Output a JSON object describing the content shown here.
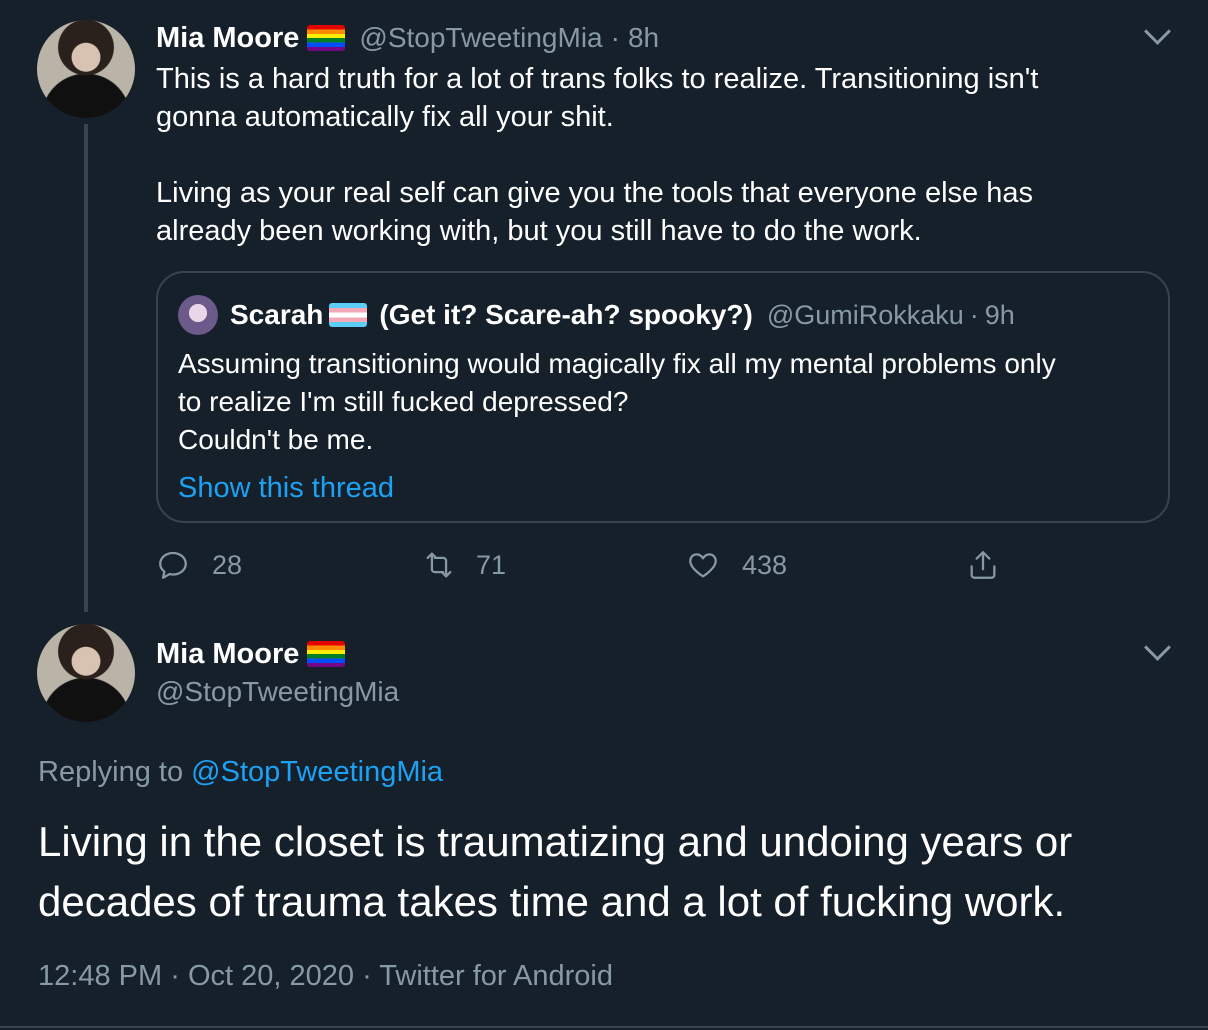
{
  "parent_tweet": {
    "author_name": "Mia Moore",
    "handle": "@StopTweetingMia",
    "separator": "·",
    "time": "8h",
    "lines": [
      "This is a hard truth for a lot of trans folks to realize. Transitioning isn't",
      "gonna automatically fix all your shit.",
      "Living as your real self can give you the tools that everyone else has",
      "already been working with, but you still have to do the work."
    ],
    "quoted": {
      "author_name": "Scarah",
      "display_suffix": "(Get it? Scare-ah? spooky?)",
      "handle": "@GumiRokkaku",
      "separator": "·",
      "time": "9h",
      "lines": [
        "Assuming transitioning would magically fix all my mental problems only",
        "to realize I'm still fucked depressed?",
        "Couldn't be me."
      ],
      "show_thread": "Show this thread"
    },
    "actions": {
      "replies": "28",
      "retweets": "71",
      "likes": "438"
    }
  },
  "main_tweet": {
    "author_name": "Mia Moore",
    "handle": "@StopTweetingMia",
    "replying_label": "Replying to",
    "replying_handle": "@StopTweetingMia",
    "lines": [
      "Living in the closet is traumatizing and undoing years or",
      "decades of trauma takes time and a lot of fucking work."
    ],
    "time": "12:48 PM",
    "separator": "·",
    "date": "Oct 20, 2020",
    "source": "Twitter for Android"
  },
  "colors": {
    "background": "#15202b",
    "secondary_text": "#8899a6",
    "link": "#1da1f2",
    "border": "#38444d"
  }
}
